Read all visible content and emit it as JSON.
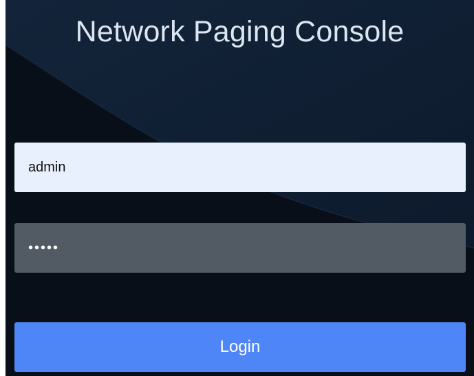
{
  "page": {
    "title": "Network Paging Console"
  },
  "login_form": {
    "username_value": "admin",
    "password_value": "passw",
    "login_label": "Login"
  },
  "colors": {
    "panel_background": "#0a1320",
    "username_field": "#e8f0fd",
    "password_field": "#525a64",
    "login_button": "#4e86f8",
    "title_text": "#dbe6f1"
  }
}
